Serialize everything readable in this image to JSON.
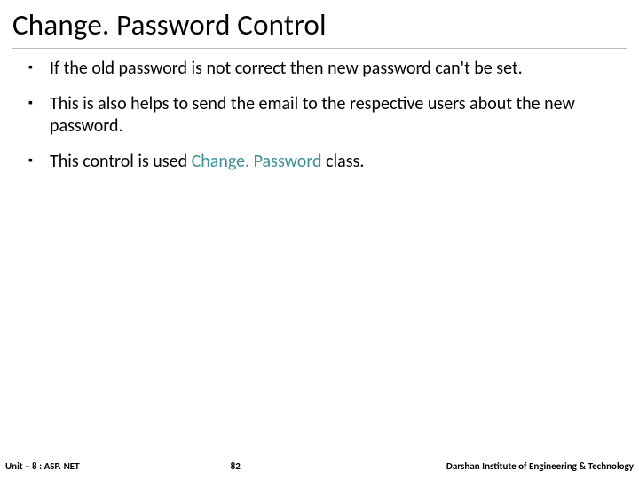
{
  "title": "Change. Password Control",
  "bullets": [
    {
      "text": "If the old password is not correct then new password can't be set."
    },
    {
      "text": "This is also helps to send the email to the respective users about the new password."
    },
    {
      "prefix": "This control is used ",
      "class_name": "Change. Password",
      "suffix": " class."
    }
  ],
  "footer": {
    "left": "Unit – 8 : ASP. NET",
    "page": "82",
    "right": "Darshan Institute of Engineering & Technology"
  }
}
